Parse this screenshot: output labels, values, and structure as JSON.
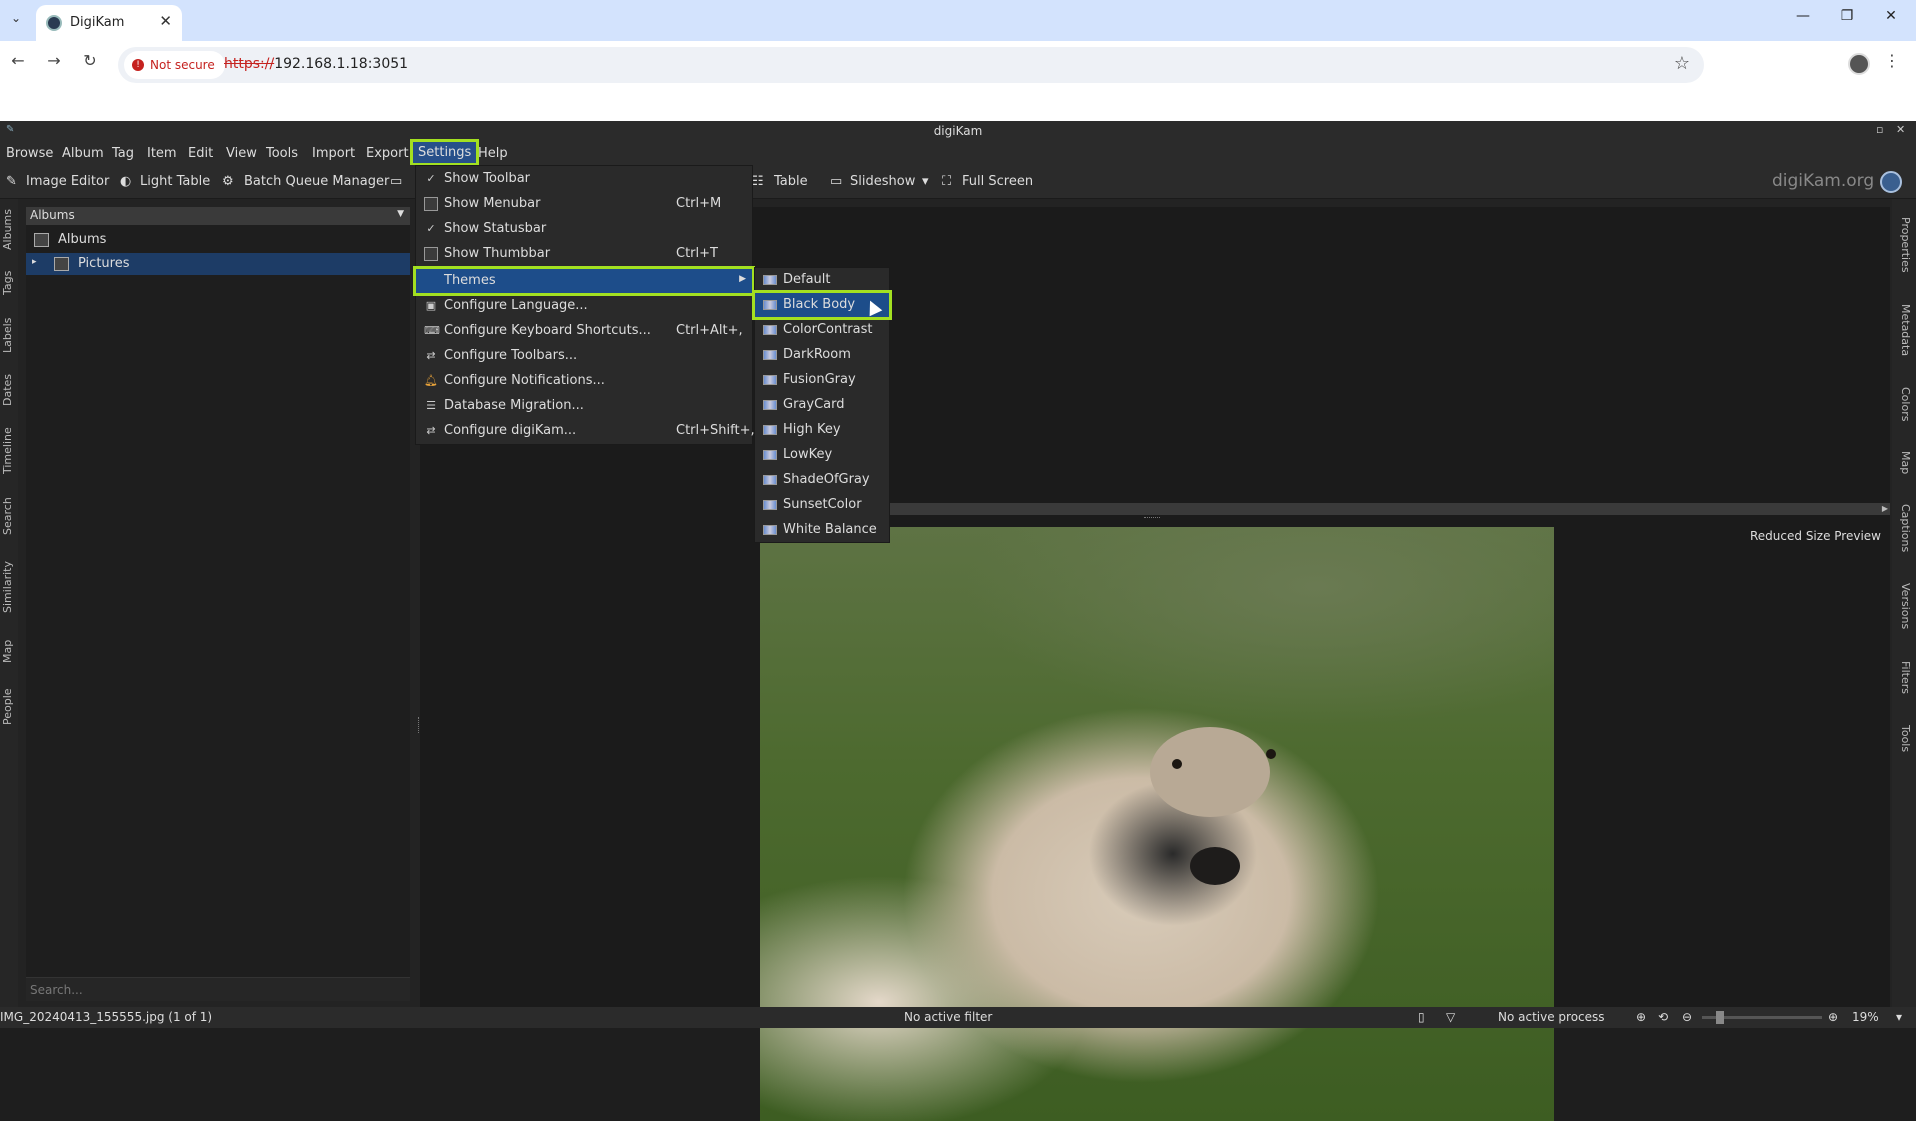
{
  "browser": {
    "tab_title": "DigiKam",
    "security_label": "Not secure",
    "url_scheme": "https://",
    "url_rest": "192.168.1.18:3051"
  },
  "window": {
    "title": "digiKam"
  },
  "menubar": [
    "Browse",
    "Album",
    "Tag",
    "Item",
    "Edit",
    "View",
    "Tools",
    "Import",
    "Export",
    "Settings",
    "Help"
  ],
  "toolbar": {
    "image_editor": "Image Editor",
    "light_table": "Light Table",
    "batch_queue": "Batch Queue Manager",
    "table": "Table",
    "slideshow": "Slideshow",
    "full_screen": "Full Screen",
    "brand": "digiKam.org"
  },
  "left_tabs": [
    "Albums",
    "Tags",
    "Labels",
    "Dates",
    "Timeline",
    "Search",
    "Similarity",
    "Map",
    "People"
  ],
  "right_tabs": [
    "Properties",
    "Metadata",
    "Colors",
    "Map",
    "Captions",
    "Versions",
    "Filters",
    "Tools"
  ],
  "albums_panel": {
    "header": "Albums",
    "root": "Albums",
    "child": "Pictures",
    "search_placeholder": "Search..."
  },
  "settings_menu": {
    "items": [
      {
        "label": "Show Toolbar",
        "shortcut": "",
        "icon": "check-icon"
      },
      {
        "label": "Show Menubar",
        "shortcut": "Ctrl+M",
        "icon": "menubar-icon"
      },
      {
        "label": "Show Statusbar",
        "shortcut": "",
        "icon": "check-icon"
      },
      {
        "label": "Show Thumbbar",
        "shortcut": "Ctrl+T",
        "icon": "thumbbar-icon"
      },
      {
        "label": "Themes",
        "shortcut": "",
        "icon": ""
      },
      {
        "label": "Configure Language...",
        "shortcut": "",
        "icon": "language-icon"
      },
      {
        "label": "Configure Keyboard Shortcuts...",
        "shortcut": "Ctrl+Alt+,",
        "icon": "keyboard-icon"
      },
      {
        "label": "Configure Toolbars...",
        "shortcut": "",
        "icon": "toolbars-icon"
      },
      {
        "label": "Configure Notifications...",
        "shortcut": "",
        "icon": "bell-icon"
      },
      {
        "label": "Database Migration...",
        "shortcut": "",
        "icon": "database-icon"
      },
      {
        "label": "Configure digiKam...",
        "shortcut": "Ctrl+Shift+,",
        "icon": "settings-icon"
      }
    ]
  },
  "themes_menu": [
    "Default",
    "Black Body",
    "ColorContrast",
    "DarkRoom",
    "FusionGray",
    "GrayCard",
    "High Key",
    "LowKey",
    "ShadeOfGray",
    "SunsetColor",
    "White Balance"
  ],
  "preview": {
    "reduced_label": "Reduced Size Preview"
  },
  "status": {
    "filename": "IMG_20240413_155555.jpg (1 of 1)",
    "filter": "No active filter",
    "process": "No active process",
    "zoom": "19%"
  },
  "colors": {
    "highlight": "#a3e021",
    "selection": "#1d4d8a"
  }
}
